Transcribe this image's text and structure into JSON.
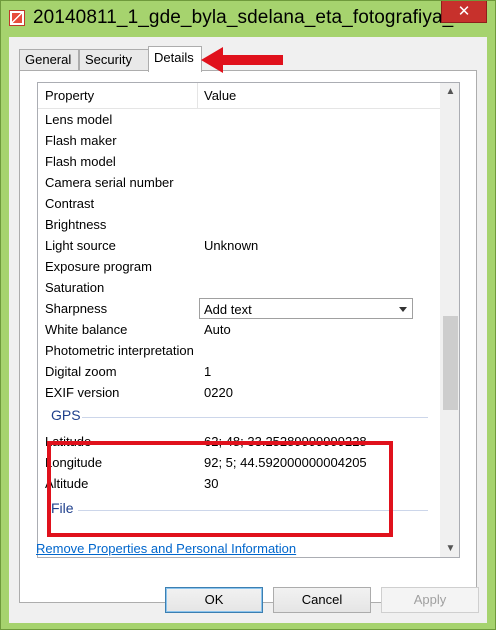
{
  "window": {
    "title": "20140811_1_gde_byla_sdelana_eta_fotografiya_...",
    "close_glyph": "✕"
  },
  "tabs": [
    {
      "label": "General"
    },
    {
      "label": "Security"
    },
    {
      "label": "Details"
    }
  ],
  "list": {
    "col_property": "Property",
    "col_value": "Value",
    "rows": [
      {
        "property": "Lens model",
        "value": ""
      },
      {
        "property": "Flash maker",
        "value": ""
      },
      {
        "property": "Flash model",
        "value": ""
      },
      {
        "property": "Camera serial number",
        "value": ""
      },
      {
        "property": "Contrast",
        "value": ""
      },
      {
        "property": "Brightness",
        "value": ""
      },
      {
        "property": "Light source",
        "value": "Unknown"
      },
      {
        "property": "Exposure program",
        "value": ""
      },
      {
        "property": "Saturation",
        "value": ""
      },
      {
        "property": "Sharpness",
        "value": "Add text"
      },
      {
        "property": "White balance",
        "value": "Auto"
      },
      {
        "property": "Photometric interpretation",
        "value": ""
      },
      {
        "property": "Digital zoom",
        "value": "1"
      },
      {
        "property": "EXIF version",
        "value": "0220"
      }
    ],
    "gps_group": "GPS",
    "gps_rows": [
      {
        "property": "Latitude",
        "value": "62; 48; 33.25289999999228"
      },
      {
        "property": "Longitude",
        "value": "92; 5; 44.592000000004205"
      },
      {
        "property": "Altitude",
        "value": "30"
      }
    ],
    "file_group": "File"
  },
  "link": "Remove Properties and Personal Information",
  "buttons": {
    "ok": "OK",
    "cancel": "Cancel",
    "apply": "Apply"
  },
  "colors": {
    "annotation": "#e0111c",
    "link": "#0066cc",
    "group": "#1e3f8c"
  },
  "icons": {
    "app": "image-file-icon",
    "arrow": "red-arrow-annotation",
    "scroll_up": "chevron-up-icon",
    "scroll_down": "chevron-down-icon"
  }
}
